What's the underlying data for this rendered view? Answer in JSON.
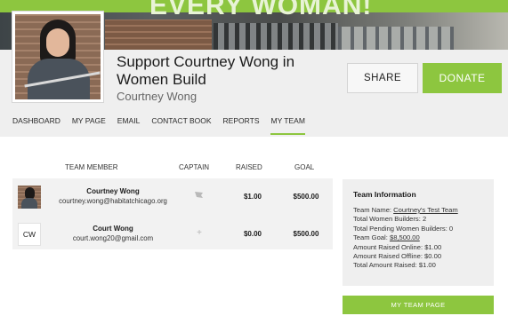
{
  "banner": {
    "slogan": "EVERY WOMAN!"
  },
  "campaign": {
    "title": "Support Courtney Wong in Women Build",
    "owner": "Courtney Wong"
  },
  "buttons": {
    "share": "SHARE",
    "donate": "DONATE",
    "team_page": "MY TEAM PAGE"
  },
  "nav": {
    "items": [
      {
        "label": "DASHBOARD"
      },
      {
        "label": "MY PAGE"
      },
      {
        "label": "EMAIL"
      },
      {
        "label": "CONTACT BOOK"
      },
      {
        "label": "REPORTS"
      },
      {
        "label": "MY TEAM",
        "active": true
      }
    ]
  },
  "team_table": {
    "headers": {
      "member": "TEAM MEMBER",
      "captain": "CAPTAIN",
      "raised": "RAISED",
      "goal": "GOAL"
    },
    "rows": [
      {
        "avatar": "photo",
        "initials": "",
        "name": "Courtney Wong",
        "email": "courtney.wong@habitatchicago.org",
        "captain_icon": "flag-icon",
        "raised": "$1.00",
        "goal": "$500.00"
      },
      {
        "avatar": "initials",
        "initials": "CW",
        "name": "Court Wong",
        "email": "court.wong20@gmail.com",
        "captain_icon": "plus-icon",
        "raised": "$0.00",
        "goal": "$500.00"
      }
    ]
  },
  "team_info": {
    "title": "Team Information",
    "team_name_label": "Team Name:",
    "team_name": "Courtney's Test Team",
    "total_builders": "Total Women Builders: 2",
    "pending_builders": "Total Pending Women Builders: 0",
    "team_goal_label": "Team Goal:",
    "team_goal": "$8,500.00",
    "raised_online": "Amount Raised Online: $1.00",
    "raised_offline": "Amount Raised Offline: $0.00",
    "raised_total": "Total Amount Raised: $1.00"
  },
  "colors": {
    "accent": "#8dc63f",
    "panel": "#efefef"
  }
}
